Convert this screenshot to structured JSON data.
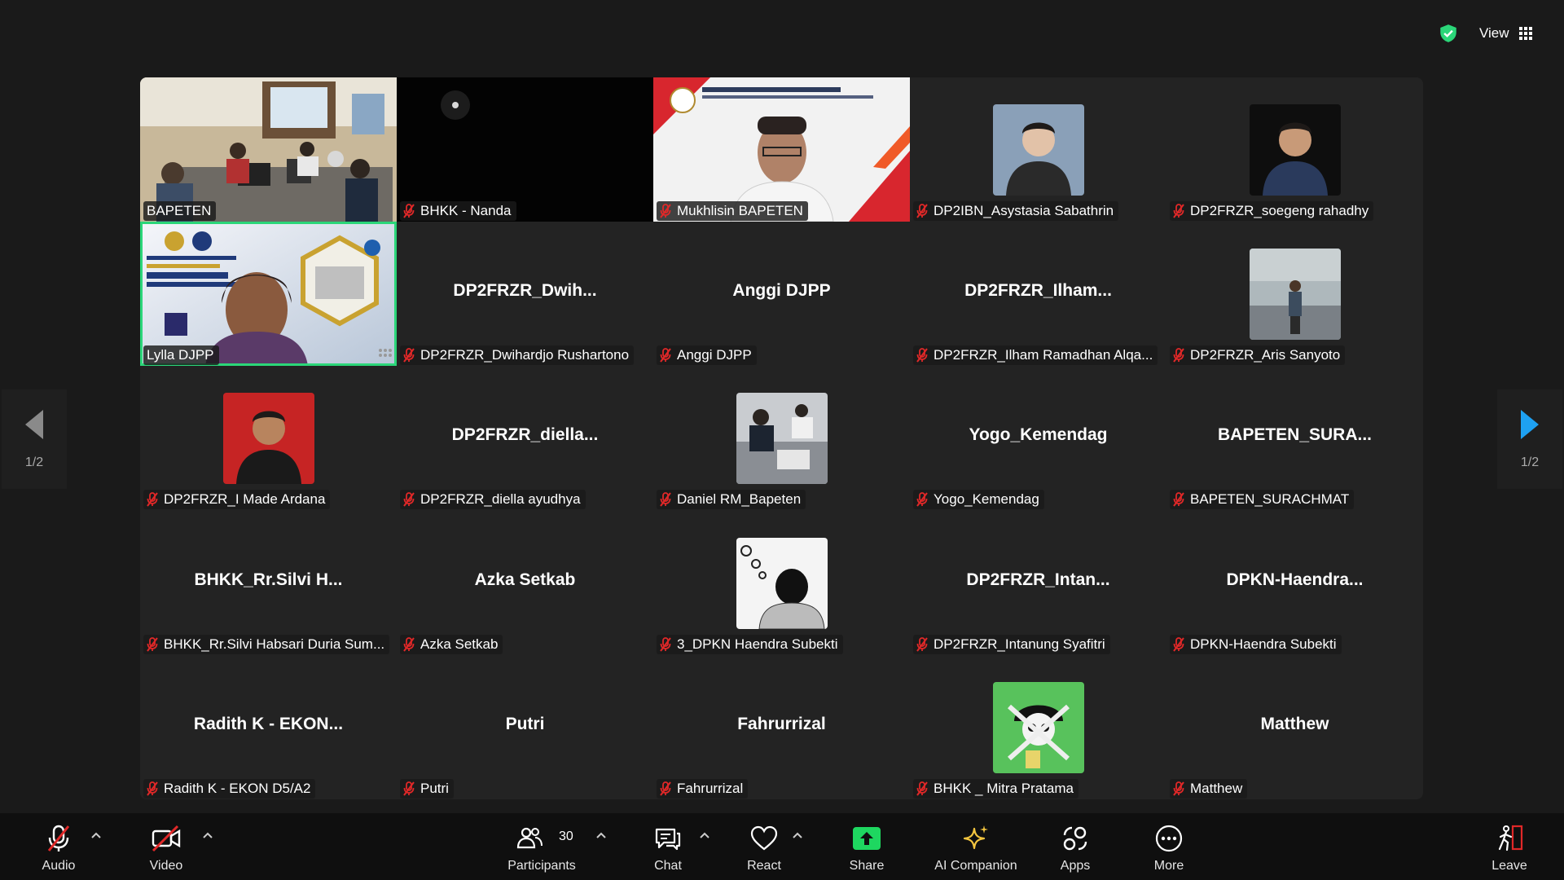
{
  "top": {
    "view_label": "View"
  },
  "pagination": {
    "prev_label": "1/2",
    "next_label": "1/2"
  },
  "tiles": [
    {
      "label": "BAPETEN",
      "muted": false,
      "kind": "video",
      "scene": "office"
    },
    {
      "label": "BHKK - Nanda",
      "muted": true,
      "kind": "video",
      "scene": "dark"
    },
    {
      "label": "Mukhlisin BAPETEN",
      "muted": true,
      "kind": "video",
      "scene": "banner"
    },
    {
      "label": "DP2IBN_Asystasia Sabathrin",
      "muted": true,
      "kind": "avatar",
      "avatar_color": "#7a8aa0"
    },
    {
      "label": "DP2FRZR_soegeng rahadhy",
      "muted": true,
      "kind": "avatar",
      "avatar_color": "#202020"
    },
    {
      "label": "Lylla DJPP",
      "muted": false,
      "kind": "video",
      "scene": "djpp",
      "active": true
    },
    {
      "label": "DP2FRZR_Dwihardjo Rushartono",
      "display": "DP2FRZR_Dwih...",
      "muted": true,
      "kind": "name"
    },
    {
      "label": "Anggi DJPP",
      "display": "Anggi DJPP",
      "muted": true,
      "kind": "name"
    },
    {
      "label": "DP2FRZR_Ilham Ramadhan Alqa...",
      "display": "DP2FRZR_Ilham...",
      "muted": true,
      "kind": "name"
    },
    {
      "label": "DP2FRZR_Aris Sanyoto",
      "muted": true,
      "kind": "avatar",
      "avatar_color": "#9aa5a8"
    },
    {
      "label": "DP2FRZR_I Made Ardana",
      "muted": true,
      "kind": "avatar",
      "avatar_color": "#c62424"
    },
    {
      "label": "DP2FRZR_diella ayudhya",
      "display": "DP2FRZR_diella...",
      "muted": true,
      "kind": "name"
    },
    {
      "label": "Daniel RM_Bapeten",
      "muted": true,
      "kind": "avatar",
      "avatar_color": "#8e9296"
    },
    {
      "label": "Yogo_Kemendag",
      "display": "Yogo_Kemendag",
      "muted": true,
      "kind": "name"
    },
    {
      "label": "BAPETEN_SURACHMAT",
      "display": "BAPETEN_SURA...",
      "muted": true,
      "kind": "name"
    },
    {
      "label": "BHKK_Rr.Silvi Habsari Duria Sum...",
      "display": "BHKK_Rr.Silvi  H...",
      "muted": true,
      "kind": "name"
    },
    {
      "label": "Azka Setkab",
      "display": "Azka Setkab",
      "muted": true,
      "kind": "name"
    },
    {
      "label": "3_DPKN Haendra Subekti",
      "muted": true,
      "kind": "avatar",
      "avatar_color": "#f2f2f2"
    },
    {
      "label": "DP2FRZR_Intanung Syafitri",
      "display": "DP2FRZR_Intan...",
      "muted": true,
      "kind": "name"
    },
    {
      "label": "DPKN-Haendra Subekti",
      "display": "DPKN-Haendra...",
      "muted": true,
      "kind": "name"
    },
    {
      "label": "Radith K - EKON D5/A2",
      "display": "Radith K - EKON...",
      "muted": true,
      "kind": "name"
    },
    {
      "label": "Putri",
      "display": "Putri",
      "muted": true,
      "kind": "name"
    },
    {
      "label": "Fahrurrizal",
      "display": "Fahrurrizal",
      "muted": true,
      "kind": "name"
    },
    {
      "label": "BHKK _ Mitra Pratama",
      "muted": true,
      "kind": "avatar",
      "avatar_color": "#58c25c"
    },
    {
      "label": "Matthew",
      "display": "Matthew",
      "muted": true,
      "kind": "name"
    }
  ],
  "toolbar": {
    "audio": "Audio",
    "video": "Video",
    "participants": "Participants",
    "participants_count": "30",
    "chat": "Chat",
    "react": "React",
    "share": "Share",
    "ai_companion": "AI Companion",
    "apps": "Apps",
    "more": "More",
    "leave": "Leave"
  },
  "colors": {
    "active_border": "#2bd679",
    "share_green": "#1ed760",
    "muted_red": "#e02828",
    "arrow_blue": "#1ea1f2"
  }
}
